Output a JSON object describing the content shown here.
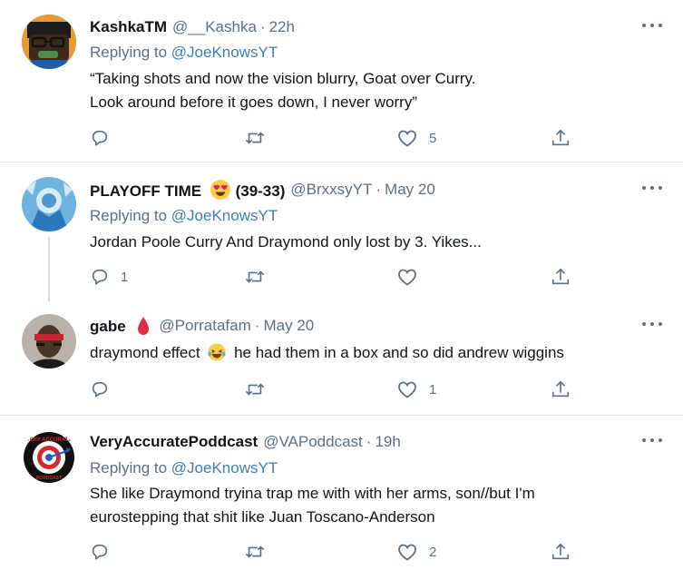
{
  "colors": {
    "text_primary": "#0f1419",
    "text_secondary": "#5b7083",
    "link": "#1da1f2",
    "divider": "#e1e8ed"
  },
  "tweets": [
    {
      "name": "KashkaTM",
      "handle": "@__Kashka",
      "dot": "·",
      "time": "22h",
      "replying_label": "Replying to",
      "replying_to": "@JoeKnowsYT",
      "text_lines": [
        "“Taking shots and now the vision blurry, Goat over Curry.",
        "Look around before it goes down, I never worry”"
      ],
      "reply_count": "",
      "retweet_count": "",
      "like_count": "5"
    },
    {
      "name_prefix": "PLAYOFF TIME",
      "name_suffix": "(39-33)",
      "name_emoji": "heart-eyes-emoji",
      "handle": "@BrxxsyYT",
      "dot": "·",
      "time": "May 20",
      "replying_label": "Replying to",
      "replying_to": "@JoeKnowsYT",
      "text_lines": [
        "Jordan Poole Curry And Draymond only lost by 3. Yikes..."
      ],
      "reply_count": "1",
      "retweet_count": "",
      "like_count": ""
    },
    {
      "name": "gabe",
      "name_emoji": "drop-of-blood-emoji",
      "handle": "@Porratafam",
      "dot": "·",
      "time": "May 20",
      "text_before_emoji": "draymond effect",
      "text_emoji": "crying-laughing-emoji",
      "text_after_emoji": "he had them in a box and so did andrew wiggins",
      "reply_count": "",
      "retweet_count": "",
      "like_count": "1"
    },
    {
      "name": "VeryAccuratePoddcast",
      "handle": "@VAPoddcast",
      "dot": "·",
      "time": "19h",
      "replying_label": "Replying to",
      "replying_to": "@JoeKnowsYT",
      "text_lines": [
        "She like Draymond tryina trap me with with her arms, son//but I'm",
        "eurostepping that shit like Juan Toscano-Anderson"
      ],
      "reply_count": "",
      "retweet_count": "",
      "like_count": "2",
      "avatar_logo_top": "VERY ACCURATE",
      "avatar_logo_bottom": "PODDCAST"
    }
  ]
}
